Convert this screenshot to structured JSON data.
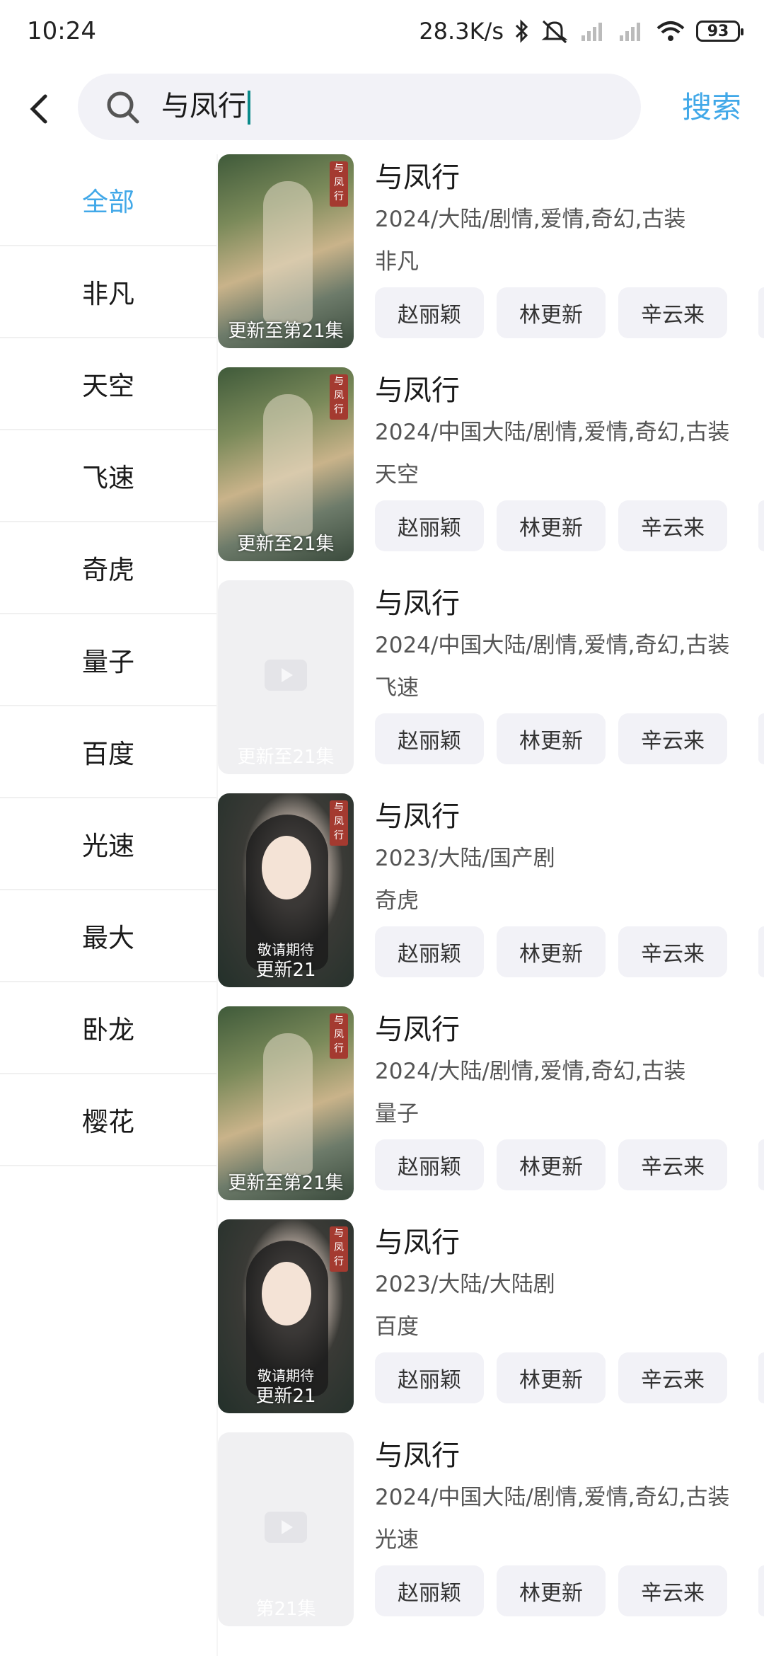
{
  "status_bar": {
    "time": "10:24",
    "speed": "28.3K/s",
    "battery": "93"
  },
  "search": {
    "query": "与凤行",
    "button": "搜索"
  },
  "sidebar": {
    "items": [
      {
        "label": "全部",
        "active": true
      },
      {
        "label": "非凡"
      },
      {
        "label": "天空"
      },
      {
        "label": "飞速"
      },
      {
        "label": "奇虎"
      },
      {
        "label": "量子"
      },
      {
        "label": "百度"
      },
      {
        "label": "光速"
      },
      {
        "label": "最大"
      },
      {
        "label": "卧龙"
      },
      {
        "label": "樱花"
      }
    ]
  },
  "results": [
    {
      "title": "与凤行",
      "meta": "2024/大陆/剧情,爱情,奇幻,古装",
      "source": "非凡",
      "episode": "更新至第21集",
      "tags": [
        "赵丽颖",
        "林更新",
        "辛云来"
      ]
    },
    {
      "title": "与凤行",
      "meta": "2024/中国大陆/剧情,爱情,奇幻,古装",
      "source": "天空",
      "episode": "更新至21集",
      "tags": [
        "赵丽颖",
        "林更新",
        "辛云来"
      ]
    },
    {
      "title": "与凤行",
      "meta": "2024/中国大陆/剧情,爱情,奇幻,古装",
      "source": "飞速",
      "episode": "更新至21集",
      "tags": [
        "赵丽颖",
        "林更新",
        "辛云来"
      ]
    },
    {
      "title": "与凤行",
      "meta": "2023/大陆/国产剧",
      "source": "奇虎",
      "episode": "更新21",
      "tags": [
        "赵丽颖",
        "林更新",
        "辛云来"
      ]
    },
    {
      "title": "与凤行",
      "meta": "2024/大陆/剧情,爱情,奇幻,古装",
      "source": "量子",
      "episode": "更新至第21集",
      "tags": [
        "赵丽颖",
        "林更新",
        "辛云来"
      ]
    },
    {
      "title": "与凤行",
      "meta": "2023/大陆/大陆剧",
      "source": "百度",
      "episode": "更新21",
      "tags": [
        "赵丽颖",
        "林更新",
        "辛云来"
      ]
    },
    {
      "title": "与凤行",
      "meta": "2024/中国大陆/剧情,爱情,奇幻,古装",
      "source": "光速",
      "episode": "第21集",
      "tags": [
        "赵丽颖",
        "林更新",
        "辛云来"
      ]
    }
  ],
  "poster_overlay_text": [
    "敬请期待",
    "与凤行"
  ],
  "colors": {
    "accent": "#41a8e8",
    "chip_bg": "#f2f2f7"
  }
}
